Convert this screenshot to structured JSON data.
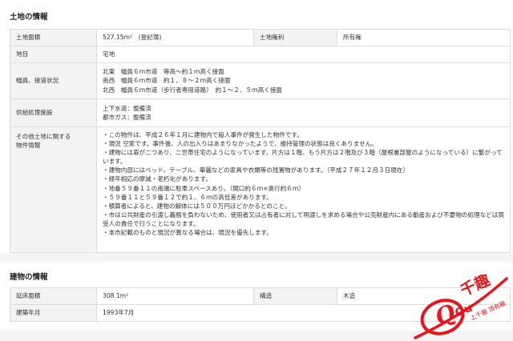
{
  "land": {
    "title": "土地の情報",
    "area_label": "土地面積",
    "area_value": "527.15m²　(登記簿)",
    "rights_label": "土地権利",
    "rights_value": "所有権",
    "type_label": "地目",
    "type_value": "宅地",
    "road_label": "幅員、接道状況",
    "road_lines": [
      "北東　幅員６ｍ市道　等高～約１ｍ高く接面",
      "南西　幅員６ｍ市道　約１、８～２ｍ高く接面",
      "北西　幅員６ｍ市道（歩行者専用道路）　約１～２、５ｍ高く接面"
    ],
    "utility_label": "供給処理施設",
    "utility_lines": [
      "上下水道：整備済",
      "都市ガス：整備済"
    ],
    "other_label_line1": "その他土地に関する",
    "other_label_line2": "物件情報",
    "other_lines": [
      "・この物件は、平成２６年１月に建物内で殺人事件が発生した物件です。",
      "・現況 空家です。事件後、人の出入りはあまりなかったようで、維持管理の状態は良くありません。",
      "・建物には扉が二つあり、二世帯住宅のようになっています。片方は１階、もう片方は２階及び３階（屋根裏部屋のようになっている）に繋がっています。",
      "・建物内部にはベッド、テーブル、華麗などの家具や衣類等の残置物があります。（平成２７年１２月３日現在）",
      "・経年相応の摩滅・老朽化があります。",
      "・地番５９番１１の南端に駐車スペースあり。（間口約６ｍ×奥行約６ｍ）",
      "・５９番１１と５９番１２で約１、６ｍの高低差があります。",
      "・積算者によると、建物の解体には５００万円ほどかかるとのこと。",
      "・市は公共財産の引渡し義務を負わないため、使用者又は占有者に対して明渡しを求める場合や公売財産内にある動産および不要物の処理などは買受人の責任で行うことになります。",
      "・本市記載のものと現況が異なる場合は、現況を優先します。"
    ]
  },
  "building": {
    "title": "建物の情報",
    "floor_label": "延床面積",
    "floor_value": "308.1m²",
    "structure_label": "構造",
    "structure_value": "木造",
    "built_label": "建築年月",
    "built_value": "1993年7月"
  },
  "watermark": {
    "brand": "千趣",
    "letters": "Qu",
    "slogan": "上千趣 頂有趣",
    "color": "#e8151b"
  }
}
